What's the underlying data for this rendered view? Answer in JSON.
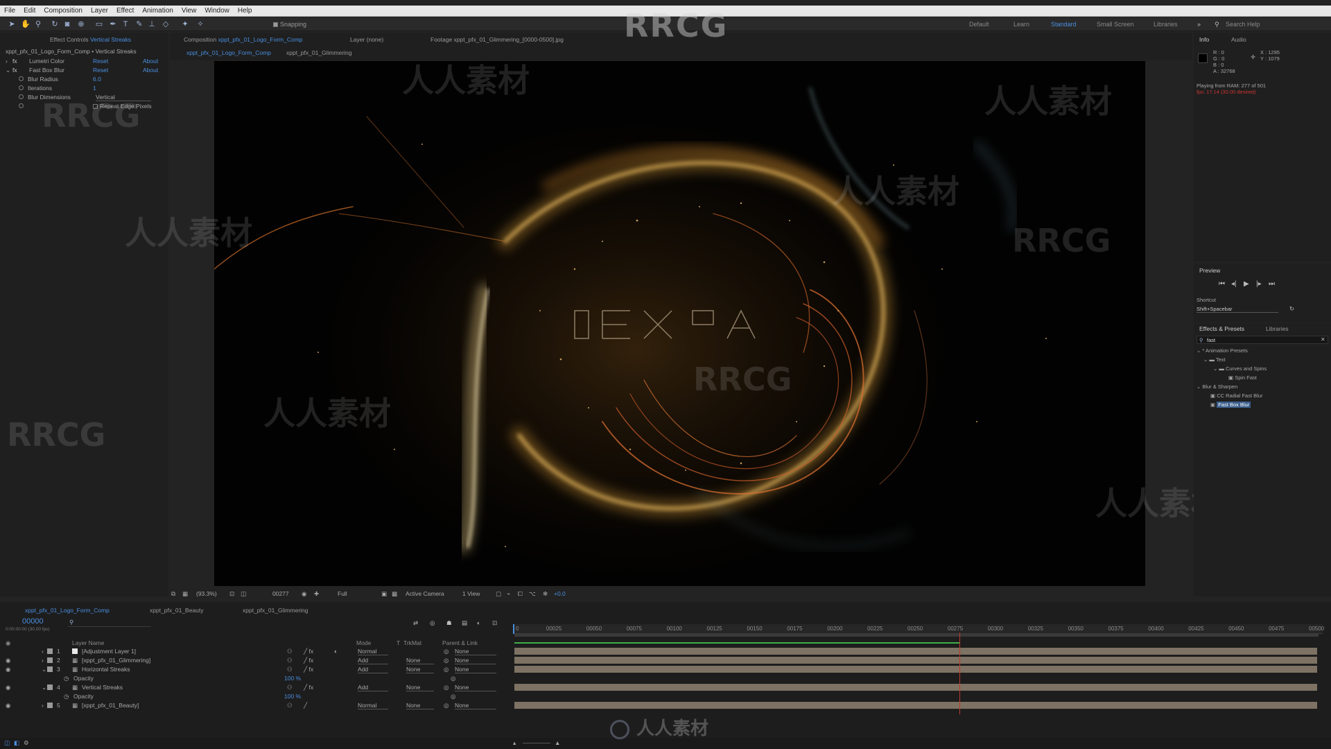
{
  "menu": [
    "File",
    "Edit",
    "Composition",
    "Layer",
    "Effect",
    "Animation",
    "View",
    "Window",
    "Help"
  ],
  "watermark_top": "RRCG",
  "watermark_bottom": "人人素材",
  "watermark_cn": "人人素材",
  "toolbar": {
    "snapping_label": "Snapping",
    "workspaces": [
      "Default",
      "Learn",
      "Standard",
      "Small Screen",
      "Libraries"
    ],
    "active_workspace": "Standard",
    "search_help": "Search Help"
  },
  "effect_controls": {
    "tab_label": "Effect Controls",
    "tab_layer": "Vertical Streaks",
    "header": "xppt_pfx_01_Logo_Form_Comp • Vertical Streaks",
    "effects": [
      {
        "name": "Lumetri Color",
        "reset": "Reset",
        "about": "About"
      },
      {
        "name": "Fast Box Blur",
        "reset": "Reset",
        "about": "About"
      }
    ],
    "props": [
      {
        "name": "Blur Radius",
        "value": "6.0"
      },
      {
        "name": "Iterations",
        "value": "1"
      },
      {
        "name": "Blur Dimensions",
        "value": "Vertical"
      }
    ],
    "repeat_edge": "Repeat Edge Pixels"
  },
  "composition_panel": {
    "comp_tab": "Composition",
    "comp_name": "xppt_pfx_01_Logo_Form_Comp",
    "layer_tab": "Layer",
    "layer_value": "(none)",
    "footage_tab": "Footage",
    "footage_value": "xppt_pfx_01_Glimmering_[0000-0500].jpg",
    "breadcrumbs": [
      "xppt_pfx_01_Logo_Form_Comp",
      "xppt_pfx_01_Glimmering"
    ]
  },
  "viewer_controls": {
    "zoom": "(93.3%)",
    "frame": "00277",
    "resolution": "Full",
    "camera": "Active Camera",
    "views": "1 View",
    "exposure": "+0.0"
  },
  "info_panel": {
    "tabs": [
      "Info",
      "Audio"
    ],
    "r": "R : 0",
    "g": "G : 0",
    "b": "B : 0",
    "a": "A : 32768",
    "x": "X : 1295",
    "y": "Y : 1079",
    "playing": "Playing from RAM: 277 of 501",
    "fps": "fps: 17.14 (30.00 desired)"
  },
  "preview": {
    "title": "Preview",
    "shortcut_label": "Shortcut",
    "shortcut_value": "Shift+Spacebar"
  },
  "effects_presets": {
    "tabs": [
      "Effects & Presets",
      "Libraries"
    ],
    "search": "fast",
    "tree": [
      {
        "label": "* Animation Presets",
        "depth": 0
      },
      {
        "label": "Text",
        "depth": 1
      },
      {
        "label": "Curves and Spins",
        "depth": 2
      },
      {
        "label": "Spin Fast",
        "depth": 3
      },
      {
        "label": "Blur & Sharpen",
        "depth": 0
      },
      {
        "label": "CC Radial Fast Blur",
        "depth": 1
      },
      {
        "label": "Fast Box Blur",
        "depth": 1
      }
    ]
  },
  "timeline": {
    "tabs": [
      "xppt_pfx_01_Logo_Form_Comp",
      "xppt_pfx_01_Beauty",
      "xppt_pfx_01_Glimmering"
    ],
    "timecode": "00000",
    "timecode_sub": "0:00:00:00 (30.00 fps)",
    "columns": {
      "layer_name": "Layer Name",
      "mode": "Mode",
      "t": "T",
      "trkmat": "TrkMat",
      "parent": "Parent & Link"
    },
    "layers": [
      {
        "num": "1",
        "name": "[Adjustment Layer 1]",
        "mode": "Normal",
        "trkmat": "",
        "parent": "None"
      },
      {
        "num": "2",
        "name": "[xppt_pfx_01_Glimmering]",
        "mode": "Add",
        "trkmat": "None",
        "parent": "None"
      },
      {
        "num": "3",
        "name": "Horizontal Streaks",
        "mode": "Add",
        "trkmat": "None",
        "parent": "None"
      },
      {
        "num": "4",
        "name": "Vertical Streaks",
        "mode": "Add",
        "trkmat": "None",
        "parent": "None"
      },
      {
        "num": "5",
        "name": "[xppt_pfx_01_Beauty]",
        "mode": "Normal",
        "trkmat": "None",
        "parent": "None"
      }
    ],
    "opacity_label": "Opacity",
    "opacity_value": "100 %",
    "ruler": [
      "00025",
      "00050",
      "00075",
      "00100",
      "00125",
      "00150",
      "00175",
      "00200",
      "00225",
      "00250",
      "00275",
      "00300",
      "00325",
      "00350",
      "00375",
      "00400",
      "00425",
      "00450",
      "00475",
      "00500"
    ],
    "ruler_start": "0",
    "current_frame": 277,
    "total_frames": 501
  },
  "colors": {
    "accent": "#4a8fe0",
    "panel": "#1f1f1f",
    "layer_bar": "#7d7263",
    "playhead": "#c0392b",
    "work_area": "#3fae49"
  }
}
